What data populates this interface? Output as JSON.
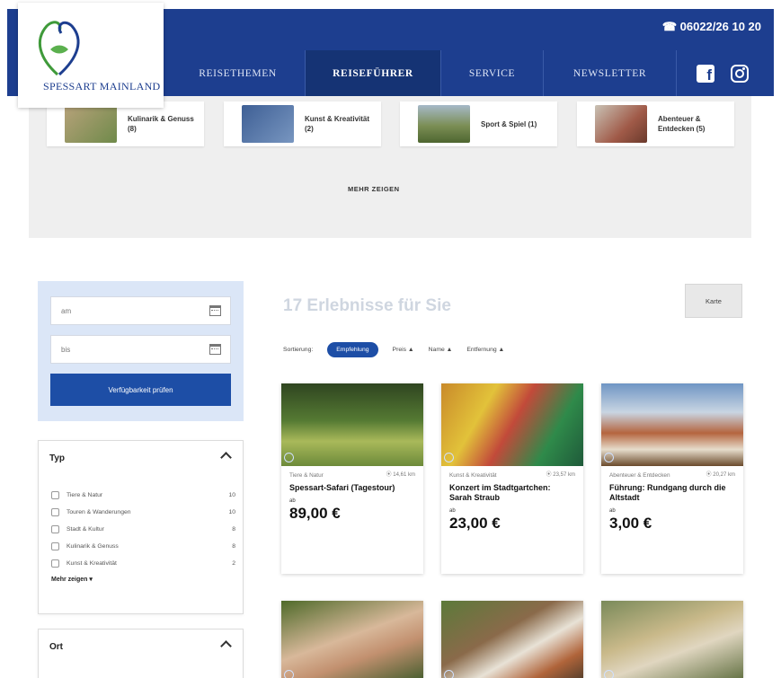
{
  "header": {
    "phone": "☎ 06022/26 10 20",
    "logo_text": "SPESSART MAINLAND",
    "nav": [
      "REISETHEMEN",
      "REISEFÜHRER",
      "SERVICE",
      "NEWSLETTER"
    ],
    "active_nav": "REISEFÜHRER"
  },
  "categories": {
    "items": [
      {
        "label": "Kulinarik & Genuss (8)",
        "color": "#8b9a6a"
      },
      {
        "label": "Kunst & Kreativität (2)",
        "color": "#4a6ea0"
      },
      {
        "label": "Sport & Spiel (1)",
        "color": "#7b8e55"
      },
      {
        "label": "Abenteuer & Entdecken (5)",
        "color": "#a05a48"
      }
    ],
    "more_label": "MEHR ZEIGEN"
  },
  "booking": {
    "from_placeholder": "am",
    "to_placeholder": "bis",
    "check_label": "Verfügbarkeit prüfen"
  },
  "filter_typ": {
    "title": "Typ",
    "rows": [
      {
        "label": "Tiere & Natur",
        "count": "10"
      },
      {
        "label": "Touren & Wanderungen",
        "count": "10"
      },
      {
        "label": "Stadt & Kultur",
        "count": "8"
      },
      {
        "label": "Kulinarik & Genuss",
        "count": "8"
      },
      {
        "label": "Kunst & Kreativität",
        "count": "2"
      }
    ],
    "show_more": "Mehr zeigen ▾"
  },
  "filter_ort": {
    "title": "Ort"
  },
  "results": {
    "title": "17 Erlebnisse für Sie",
    "map_label": "Karte",
    "sort_label": "Sortierung:",
    "sort_options": [
      "Empfehlung",
      "Preis ▲",
      "Name ▲",
      "Entfernung ▲"
    ],
    "cards": [
      {
        "category": "Tiere & Natur",
        "distance": "⦿ 14,61 km",
        "title": "Spessart-Safari (Tagestour)",
        "from": "ab",
        "price": "89,00 €",
        "img_color": "#3f5a2a"
      },
      {
        "category": "Kunst & Kreativität",
        "distance": "⦿ 23,57 km",
        "title": "Konzert im Stadtgartchen: Sarah Straub",
        "from": "ab",
        "price": "23,00 €",
        "img_color": "#3a8a4a"
      },
      {
        "category": "Abenteuer & Entdecken",
        "distance": "⦿ 20,27 km",
        "title": "Führung: Rundgang durch die Altstadt",
        "from": "ab",
        "price": "3,00 €",
        "img_color": "#9a5a40"
      },
      {
        "img_color": "#6a7a4a"
      },
      {
        "img_color": "#8a6a4a"
      },
      {
        "img_color": "#7a8a5a"
      }
    ]
  }
}
